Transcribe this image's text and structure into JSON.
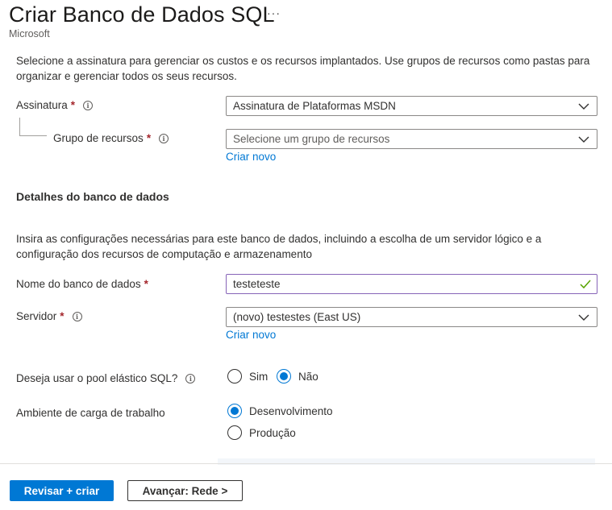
{
  "header": {
    "title": "Criar Banco de Dados SQL",
    "more_label": "···",
    "subtitle": "Microsoft"
  },
  "intro": {
    "description": "Selecione a assinatura para gerenciar os custos e os recursos implantados. Use grupos de recursos como pastas para organizar e gerenciar todos os seus recursos."
  },
  "subscription": {
    "label": "Assinatura",
    "required_mark": "*",
    "info_icon": "info-icon",
    "value": "Assinatura de Plataformas MSDN"
  },
  "resource_group": {
    "label": "Grupo de recursos",
    "required_mark": "*",
    "info_icon": "info-icon",
    "placeholder": "Selecione um grupo de recursos",
    "create_new_label": "Criar novo"
  },
  "database_details": {
    "section_title": "Detalhes do banco de dados",
    "description": "Insira as configurações necessárias para este banco de dados, incluindo a escolha de um servidor lógico e a configuração dos recursos de computação e armazenamento"
  },
  "database_name": {
    "label": "Nome do banco de dados",
    "required_mark": "*",
    "value": "testeteste",
    "valid_icon": "checkmark-icon"
  },
  "server": {
    "label": "Servidor",
    "required_mark": "*",
    "info_icon": "info-icon",
    "value": "(novo) testestes (East US)",
    "create_new_label": "Criar novo"
  },
  "elastic_pool": {
    "label": "Deseja usar o pool elástico SQL?",
    "info_icon": "info-icon",
    "options": [
      {
        "label": "Sim",
        "selected": false
      },
      {
        "label": "Não",
        "selected": true
      }
    ]
  },
  "workload": {
    "label": "Ambiente de carga de trabalho",
    "options": [
      {
        "label": "Desenvolvimento",
        "selected": true
      },
      {
        "label": "Produção",
        "selected": false
      }
    ]
  },
  "footer": {
    "primary_label": "Revisar + criar",
    "secondary_label": "Avançar: Rede >"
  },
  "colors": {
    "accent": "#0078d4",
    "required": "#a4262c",
    "valid": "#57a300",
    "focus_border": "#8764b8"
  }
}
